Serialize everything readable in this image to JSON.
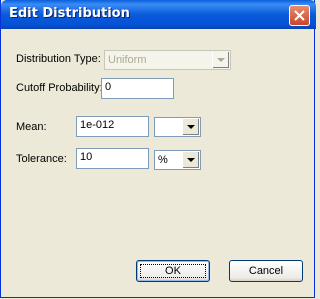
{
  "window": {
    "title": "Edit Distribution"
  },
  "distribution_type": {
    "label": "Distribution Type:",
    "value": "Uniform"
  },
  "cutoff": {
    "label": "Cutoff Probability:",
    "value": "0"
  },
  "mean": {
    "label": "Mean:",
    "value": "1e-012",
    "unit": ""
  },
  "tolerance": {
    "label": "Tolerance:",
    "value": "10",
    "unit": "%"
  },
  "buttons": {
    "ok": "OK",
    "cancel": "Cancel"
  },
  "icons": {
    "close": "close-icon",
    "dropdown": "chevron-down-icon"
  },
  "colors": {
    "titlebar": "#0A5ADB",
    "close": "#C7472A",
    "background": "#ECE9D8"
  }
}
